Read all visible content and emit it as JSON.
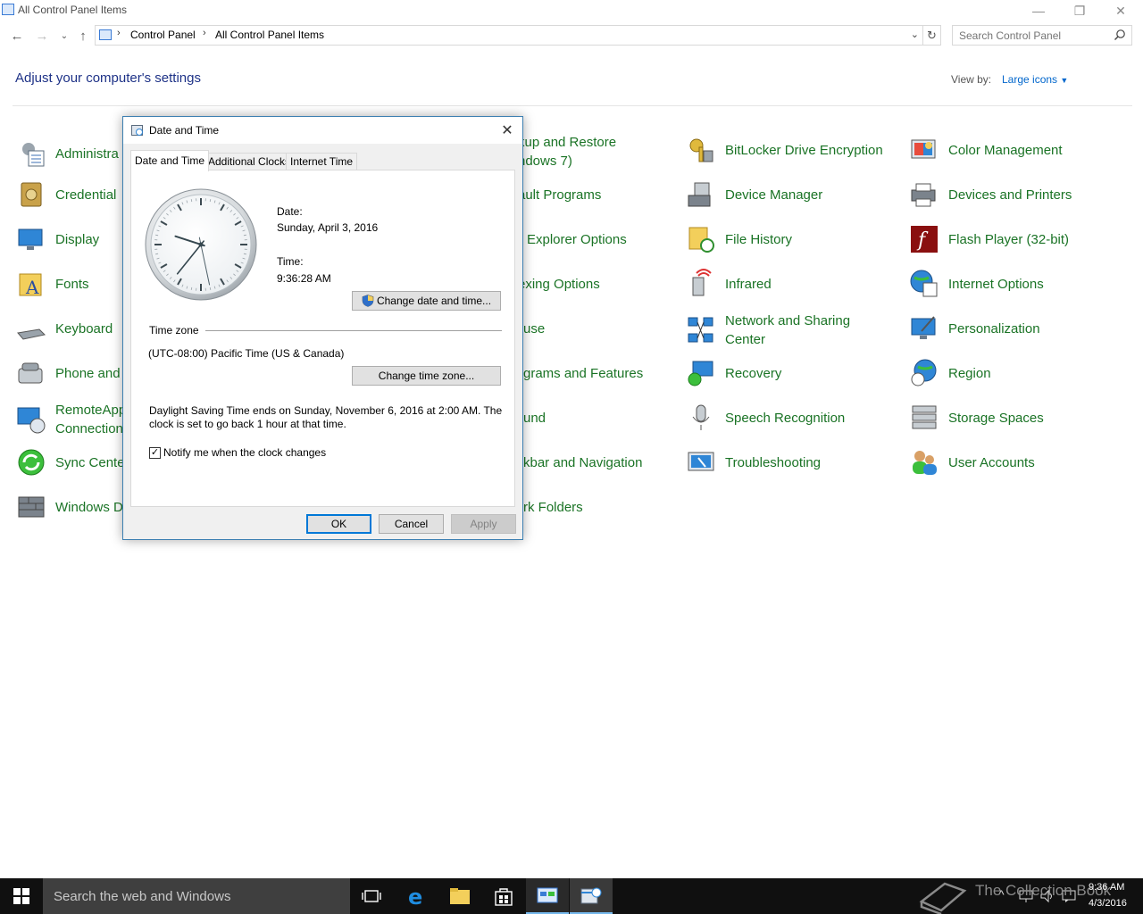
{
  "window": {
    "title": "All Control Panel Items"
  },
  "address": {
    "crumbs": [
      "Control Panel",
      "All Control Panel Items"
    ]
  },
  "search": {
    "placeholder": "Search Control Panel"
  },
  "header": {
    "title": "Adjust your computer's settings",
    "view_by_label": "View by:",
    "view_by_value": "Large icons"
  },
  "items": {
    "col1": [
      "Administra",
      "Credential",
      "Display",
      "Fonts",
      "Keyboard",
      "Phone and",
      "RemoteApp",
      "Connection",
      "Sync Cente",
      "Windows D"
    ],
    "col3": [
      "kup and Restore",
      "ndows 7)",
      "ault Programs",
      "Explorer Options",
      "exing Options",
      "use",
      "grams and Features",
      "und",
      "kbar and Navigation",
      "rk Folders"
    ],
    "col4": [
      "BitLocker Drive Encryption",
      "Device Manager",
      "File History",
      "Infrared",
      "Network and Sharing",
      "Center",
      "Recovery",
      "Speech Recognition",
      "Troubleshooting"
    ],
    "col5": [
      "Color Management",
      "Devices and Printers",
      "Flash Player (32-bit)",
      "Internet Options",
      "Personalization",
      "Region",
      "Storage Spaces",
      "User Accounts"
    ]
  },
  "dialog": {
    "title": "Date and Time",
    "tabs": [
      "Date and Time",
      "Additional Clocks",
      "Internet Time"
    ],
    "date_label": "Date:",
    "date_value": "Sunday, April 3, 2016",
    "time_label": "Time:",
    "time_value": "9:36:28 AM",
    "change_datetime_button": "Change date and time...",
    "timezone_heading": "Time zone",
    "timezone_value": "(UTC-08:00) Pacific Time (US & Canada)",
    "change_timezone_button": "Change time zone...",
    "dst_line1": "Daylight Saving Time ends on Sunday, November 6, 2016 at 2:00 AM. The",
    "dst_line2": "clock is set to go back 1 hour at that time.",
    "notify_label": "Notify me when the clock changes",
    "notify_checked": true,
    "ok": "OK",
    "cancel": "Cancel",
    "apply": "Apply",
    "clock": {
      "hours": 9,
      "minutes": 36,
      "seconds": 28
    }
  },
  "taskbar": {
    "search_placeholder": "Search the web and Windows",
    "time": "9:36 AM",
    "date": "4/3/2016",
    "watermark": "The Collection Book"
  },
  "colors": {
    "link_green": "#1a7325",
    "heading_blue": "#1e3287",
    "accent": "#0078d7"
  }
}
